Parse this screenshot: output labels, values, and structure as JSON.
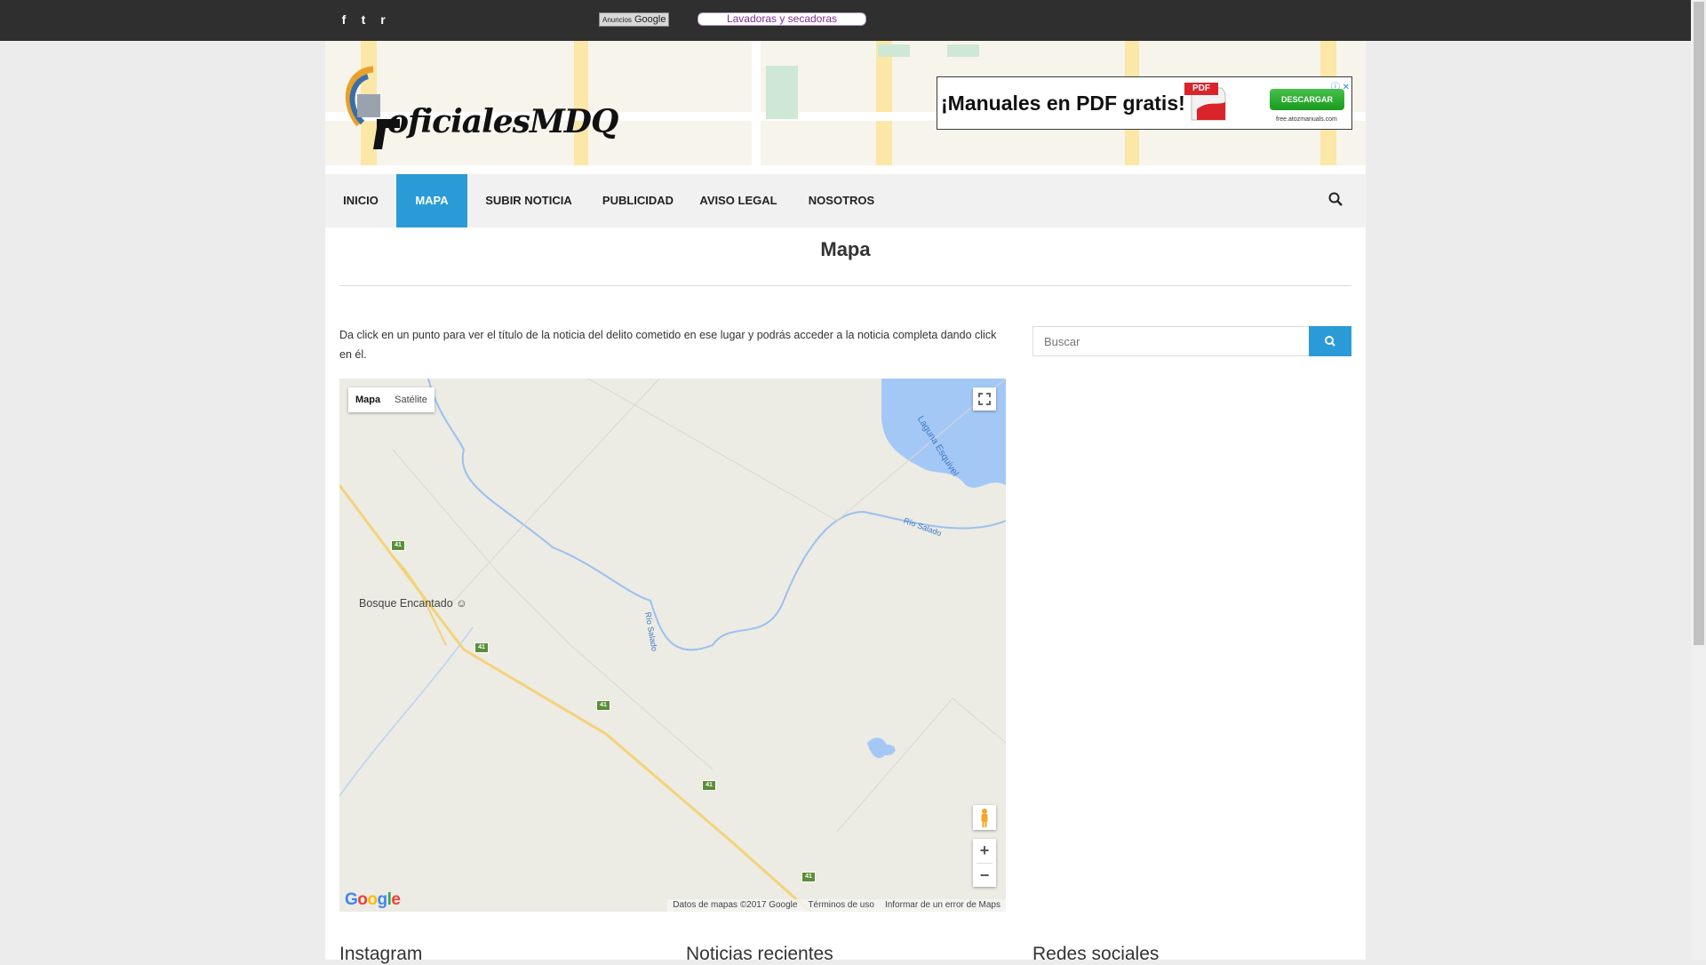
{
  "topbar": {
    "social_icons": [
      "facebook-icon",
      "twitter-icon",
      "rss-icon"
    ],
    "social_glyphs": [
      "f",
      "t",
      "r"
    ],
    "adchoices_prefix": "Anuncios",
    "adchoices_brand": "Google",
    "ad_link": "Lavadoras y secadoras"
  },
  "header": {
    "logo_text": "oficialesMDQ",
    "banner": {
      "title": "¡Manuales en PDF gratis!",
      "pdf_label": "PDF",
      "button": "DESCARGAR",
      "url": "free.atozmanuals.com"
    }
  },
  "nav": {
    "items": [
      "INICIO",
      "MAPA",
      "SUBIR NOTICIA",
      "PUBLICIDAD",
      "AVISO LEGAL",
      "NOSOTROS"
    ],
    "active": "MAPA"
  },
  "page": {
    "title": "Mapa",
    "intro": "Da click en un punto para ver el título de la noticia del delito cometido en ese lugar y podrás acceder a la noticia completa dando click en él."
  },
  "map": {
    "type_buttons": [
      "Mapa",
      "Satélite"
    ],
    "selected_type": "Mapa",
    "place": "Bosque Encantado",
    "route_number": "41",
    "rivers": [
      "Río Salado",
      "Río Salado"
    ],
    "lake": "Laguna Esquivel",
    "footer": [
      "Datos de mapas ©2017 Google",
      "Términos de uso",
      "Informar de un error de Maps"
    ],
    "zoom_in": "+",
    "zoom_out": "−",
    "google_letters": [
      "G",
      "o",
      "o",
      "g",
      "l",
      "e"
    ],
    "google_colors": [
      "#4285f4",
      "#ea4335",
      "#fbbc05",
      "#4285f4",
      "#34a853",
      "#ea4335"
    ]
  },
  "sidebar": {
    "search_placeholder": "Buscar"
  },
  "widgets": [
    "Instagram",
    "Noticias recientes",
    "Redes sociales"
  ],
  "colors": {
    "accent": "#2a9bd6",
    "topbar": "#2f2f2f"
  }
}
